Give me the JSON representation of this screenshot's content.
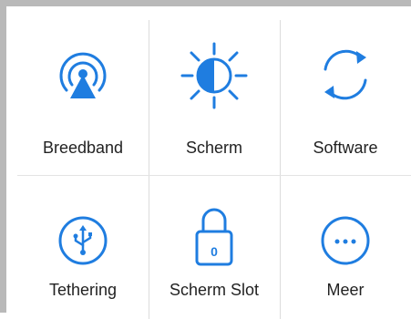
{
  "colors": {
    "accent": "#1f7de0",
    "text": "#222222",
    "divider": "#dcdcdc"
  },
  "tiles": [
    {
      "label": "Breedband",
      "icon": "broadband-icon"
    },
    {
      "label": "Scherm",
      "icon": "brightness-icon"
    },
    {
      "label": "Software",
      "icon": "sync-icon"
    },
    {
      "label": "Tethering",
      "icon": "usb-icon"
    },
    {
      "label": "Scherm Slot",
      "icon": "lock-icon"
    },
    {
      "label": "Meer",
      "icon": "more-icon"
    }
  ],
  "lock": {
    "digit": "0"
  },
  "more": {
    "dots": "···"
  }
}
